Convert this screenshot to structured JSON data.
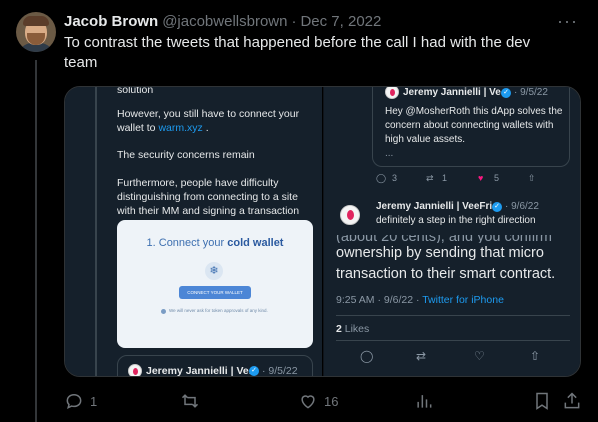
{
  "tweet": {
    "author_name": "Jacob Brown",
    "author_handle": "@jacobwellsbrown",
    "separator": "·",
    "date": "Dec 7, 2022",
    "text": "To contrast the tweets that happened before the call I had with the dev team",
    "more_label": "···"
  },
  "left_panel": {
    "top_cut": "solution",
    "p1_prefix": "However, you still have to connect your wallet to ",
    "p1_link": "warm.xyz",
    "p1_suffix": " .",
    "p2": "The security concerns remain",
    "p3": "Furthermore, people have difficulty distinguishing from connecting to a site with their MM and signing a transaction",
    "wallet_title_prefix": "1. Connect your ",
    "wallet_title_bold": "cold wallet",
    "wallet_button": "CONNECT YOUR WALLET",
    "wallet_note": "We will never ask for token approvals of any kind.",
    "quote_name": "Jeremy Jannielli | Ve...",
    "quote_date": "· 9/5/22"
  },
  "right_panel": {
    "quote_name": "Jeremy Jannielli | Ve...",
    "quote_date": "· 9/5/22",
    "quote_text": "Hey @MosherRoth this dApp solves the concern about connecting wallets with high value assets.",
    "quote_ellipsis": "...",
    "replies": "3",
    "retweets": "1",
    "likes": "5",
    "reply_name": "Jeremy Jannielli | VeeFri...",
    "reply_date": "· 9/6/22",
    "reply_text": "definitely a step in the right direction",
    "big_cut": "(about 20 cents), and you confirm",
    "big_text": "ownership by sending that micro transaction to their smart contract.",
    "time": "9:25 AM · 9/6/22 · ",
    "source": "Twitter for iPhone",
    "like_count": "2",
    "like_label": " Likes"
  },
  "actions": {
    "replies": "1",
    "likes": "16"
  },
  "colors": {
    "accent": "#1d9bf0",
    "like": "#f91880",
    "muted": "#71767b"
  }
}
